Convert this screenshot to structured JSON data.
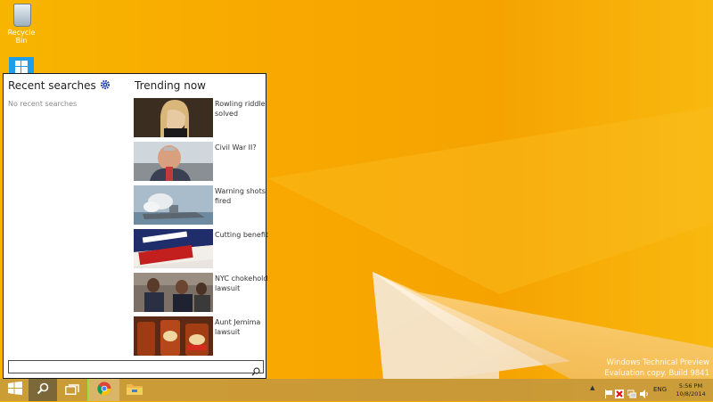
{
  "desktop": {
    "recycle_bin_label": "Recycle Bin"
  },
  "search_panel": {
    "recent_title": "Recent searches",
    "no_recent_text": "No recent searches",
    "trending_title": "Trending now",
    "search_box_value": "",
    "trending_items": [
      {
        "label": "Rowling riddle solved"
      },
      {
        "label": "Civil War II?"
      },
      {
        "label": "Warning shots fired"
      },
      {
        "label": "Cutting benefit"
      },
      {
        "label": "NYC chokehold lawsuit"
      },
      {
        "label": "Aunt Jemima lawsuit"
      }
    ]
  },
  "taskbar": {
    "buttons": [
      "start-icon",
      "search-icon",
      "task-view-icon",
      "chrome-icon",
      "file-explorer-icon"
    ],
    "tray": {
      "language": "ENG",
      "time": "5:56 PM",
      "date": "10/8/2014"
    }
  },
  "watermark": {
    "line1": "Windows Technical Preview",
    "line2": "Evaluation copy. Build 9841"
  },
  "colors": {
    "wallpaper": "#f7b000",
    "accent": "#1e9de8",
    "panel_border": "#1c1c1c"
  }
}
